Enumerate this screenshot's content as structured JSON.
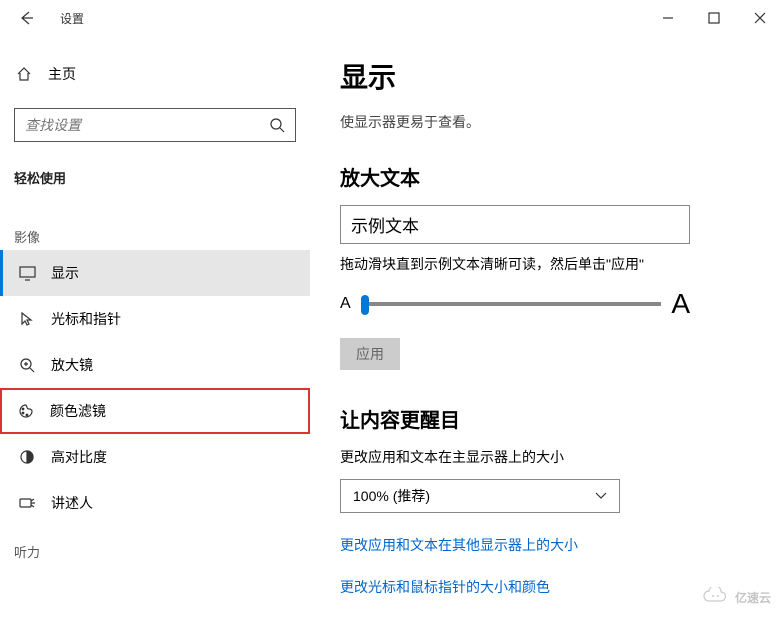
{
  "titlebar": {
    "app_name": "设置"
  },
  "sidebar": {
    "home": "主页",
    "search_placeholder": "查找设置",
    "category": "轻松使用",
    "group_visual": "影像",
    "group_audio": "听力",
    "items": [
      {
        "label": "显示"
      },
      {
        "label": "光标和指针"
      },
      {
        "label": "放大镜"
      },
      {
        "label": "颜色滤镜"
      },
      {
        "label": "高对比度"
      },
      {
        "label": "讲述人"
      }
    ]
  },
  "main": {
    "title": "显示",
    "subtitle": "使显示器更易于查看。",
    "section_text": "放大文本",
    "sample_text": "示例文本",
    "slider_caption": "拖动滑块直到示例文本清晰可读，然后单击\"应用\"",
    "apply": "应用",
    "section_scale": "让内容更醒目",
    "scale_desc": "更改应用和文本在主显示器上的大小",
    "scale_value": "100% (推荐)",
    "link_other_displays": "更改应用和文本在其他显示器上的大小",
    "link_cursor": "更改光标和鼠标指针的大小和颜色"
  },
  "watermark": "亿速云"
}
